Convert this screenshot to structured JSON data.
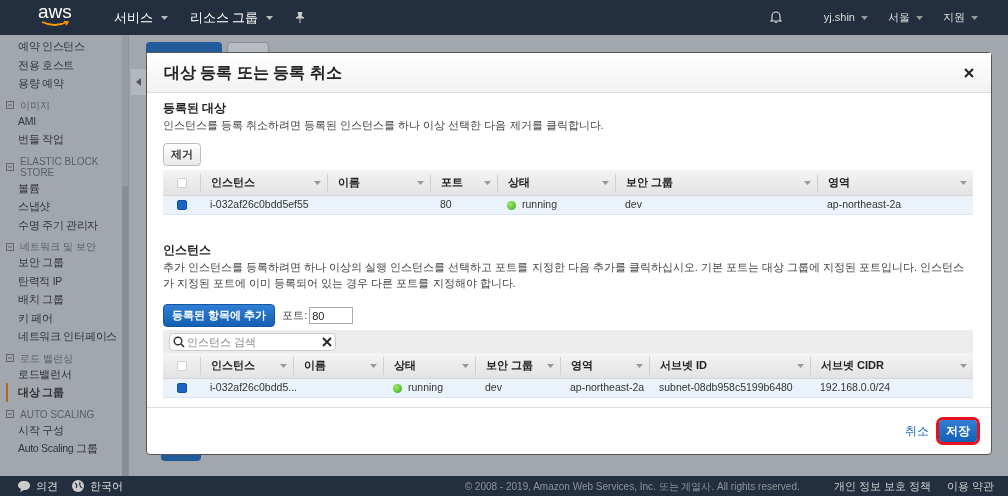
{
  "nav": {
    "logo": "aws",
    "menus": [
      {
        "label": "서비스"
      },
      {
        "label": "리소스 그룹"
      }
    ],
    "right_menus": [
      "yj.shin",
      "서울",
      "지원"
    ]
  },
  "sidebar": {
    "groups": [
      {
        "items": [
          {
            "label": "예약 인스턴스",
            "selected": false
          },
          {
            "label": "전용 호스트",
            "selected": false
          },
          {
            "label": "용량 예약",
            "selected": false
          }
        ]
      },
      {
        "title": "이미지",
        "expanded": true,
        "items": [
          {
            "label": "AMI",
            "selected": false
          },
          {
            "label": "번들 작업",
            "selected": false
          }
        ]
      },
      {
        "title": "ELASTIC BLOCK STORE",
        "expanded": true,
        "items": [
          {
            "label": "볼륨",
            "selected": false
          },
          {
            "label": "스냅샷",
            "selected": false
          },
          {
            "label": "수명 주기 관리자",
            "selected": false
          }
        ]
      },
      {
        "title": "네트워크 및 보안",
        "expanded": true,
        "items": [
          {
            "label": "보안 그룹",
            "selected": false
          },
          {
            "label": "탄력적 IP",
            "selected": false
          },
          {
            "label": "배치 그룹",
            "selected": false
          },
          {
            "label": "키 페어",
            "selected": false
          },
          {
            "label": "네트워크 인터페이스",
            "selected": false
          }
        ]
      },
      {
        "title": "로드 밸런싱",
        "expanded": true,
        "items": [
          {
            "label": "로드밸런서",
            "selected": false
          },
          {
            "label": "대상 그룹",
            "selected": true
          }
        ]
      },
      {
        "title": "AUTO SCALING",
        "expanded": true,
        "items": [
          {
            "label": "시작 구성",
            "selected": false
          },
          {
            "label": "Auto Scaling 그룹",
            "selected": false
          }
        ]
      }
    ]
  },
  "dialog": {
    "title": "대상 등록 또는 등록 취소",
    "registered": {
      "heading": "등록된 대상",
      "description": "인스턴스를 등록 취소하려면 등록된 인스턴스를 하나 이상 선택한 다음 제거를 클릭합니다.",
      "remove_button": "제거",
      "table": {
        "all_checked": false,
        "columns": [
          "인스턴스",
          "이름",
          "포트",
          "상태",
          "보안 그룹",
          "영역"
        ],
        "rows": [
          {
            "checked": true,
            "instance": "i-032af26c0bdd5ef55",
            "port": "80",
            "status": "running",
            "security_group": "dev",
            "zone": "ap-northeast-2a"
          }
        ]
      }
    },
    "instances": {
      "heading": "인스턴스",
      "description": "추가 인스턴스를 등록하려면 하나 이상의 실행 인스턴스를 선택하고 포트를 지정한 다음 추가를 클릭하십시오. 기본 포트는 대상 그룹에 지정된 포트입니다. 인스턴스가 지정된 포트에 이미 등록되어 있는 경우 다른 포트를 지정해야 합니다.",
      "add_button": "등록된 항목에 추가",
      "port_label": "포트:",
      "port_value": "80",
      "search": {
        "placeholder": "인스턴스 검색"
      },
      "table": {
        "all_checked": false,
        "columns": [
          "인스턴스",
          "이름",
          "상태",
          "보안 그룹",
          "영역",
          "서브넷 ID",
          "서브넷 CIDR"
        ],
        "rows": [
          {
            "checked": true,
            "instance": "i-032af26c0bdd5...",
            "status": "running",
            "security_group": "dev",
            "zone": "ap-northeast-2a",
            "subnet_id": "subnet-08db958c5199b6480",
            "subnet_cidr": "192.168.0.0/24"
          }
        ]
      }
    },
    "cancel": "취소",
    "save": "저장",
    "save_highlighted": true
  },
  "footer": {
    "feedback": "의견",
    "language": "한국어",
    "copyright": "© 2008 - 2019, Amazon Web Services, Inc. 또는 계열사. All rights reserved.",
    "links": [
      "개인 정보 보호 정책",
      "이용 약관"
    ]
  }
}
